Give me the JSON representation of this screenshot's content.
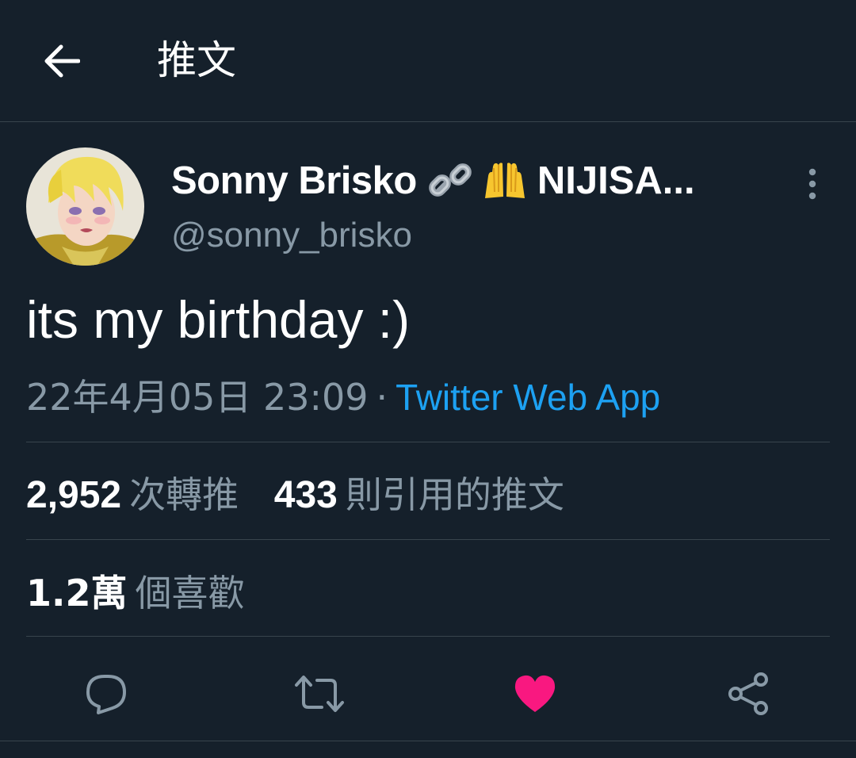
{
  "header": {
    "title": "推文",
    "back_icon": "arrow-left-icon"
  },
  "tweet": {
    "author_name": "Sonny Brisko",
    "author_name_suffix": "NIJISA...",
    "name_emojis": [
      "link-emoji-icon",
      "raising-hands-emoji-icon"
    ],
    "handle": "@sonny_brisko",
    "text": "its my birthday :)",
    "date": "22年4月05日 23:09",
    "separator": "·",
    "source": "Twitter Web App"
  },
  "stats": {
    "retweets_count": "2,952",
    "retweets_label": "次轉推",
    "quotes_count": "433",
    "quotes_label": "則引用的推文",
    "likes_count": "1.2萬",
    "likes_label": "個喜歡"
  },
  "actions": [
    "reply-icon",
    "retweet-icon",
    "like-icon",
    "share-icon"
  ],
  "colors": {
    "background": "#15202b",
    "divider": "#38444d",
    "secondary_text": "#8899a6",
    "link": "#1da1f2",
    "like": "#f91880"
  }
}
